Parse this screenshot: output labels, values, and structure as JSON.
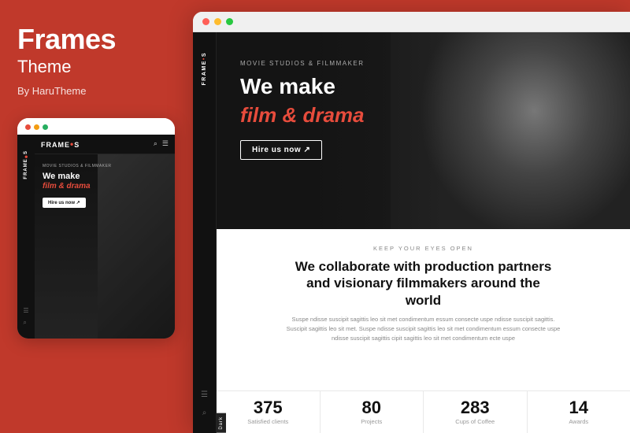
{
  "left": {
    "title": "Frames",
    "subtitle": "Theme",
    "author": "By HaruTheme",
    "mockup": {
      "dots": [
        "red",
        "yellow",
        "green"
      ],
      "brand": "FRAME",
      "brand_dot": "•S",
      "tagline": "MOVIE STUDIOS & FILMMAKER",
      "hero_title_line1": "We make",
      "hero_title_line2": "film & drama",
      "cta": "Hire us now ↗"
    }
  },
  "right": {
    "browser": {
      "dots": [
        "red",
        "yellow",
        "green"
      ]
    },
    "sidebar": {
      "brand": "FRAME",
      "brand_dot": "•S"
    },
    "hero": {
      "tagline": "MOVIE STUDIOS & FILMMAKER",
      "title_line1": "We make",
      "title_italic": "film & drama",
      "cta": "Hire us now ↗"
    },
    "section2": {
      "eyebrow": "KEEP YOUR EYES OPEN",
      "title": "We collaborate with production partners\nand visionary filmmakers around the\nworld",
      "body": "Suspe ndisse suscipit sagittis leo sit met condimentum essum consecte uspe ndisse suscipit sagittis.\nSuscipit sagittis leo sit met. Suspe ndisse suscipit sagittis leo sit met condimentum essum consecte uspe\nndisse suscipit sagittis cipit sagittis leo sit met condimentum ecte uspe"
    },
    "stats": [
      {
        "number": "375",
        "label": "Satisfied clients"
      },
      {
        "number": "80",
        "label": "Projects"
      },
      {
        "number": "283",
        "label": "Cups of Coffee"
      },
      {
        "number": "14",
        "label": "Awards"
      }
    ],
    "dark_pill": "Dark"
  }
}
